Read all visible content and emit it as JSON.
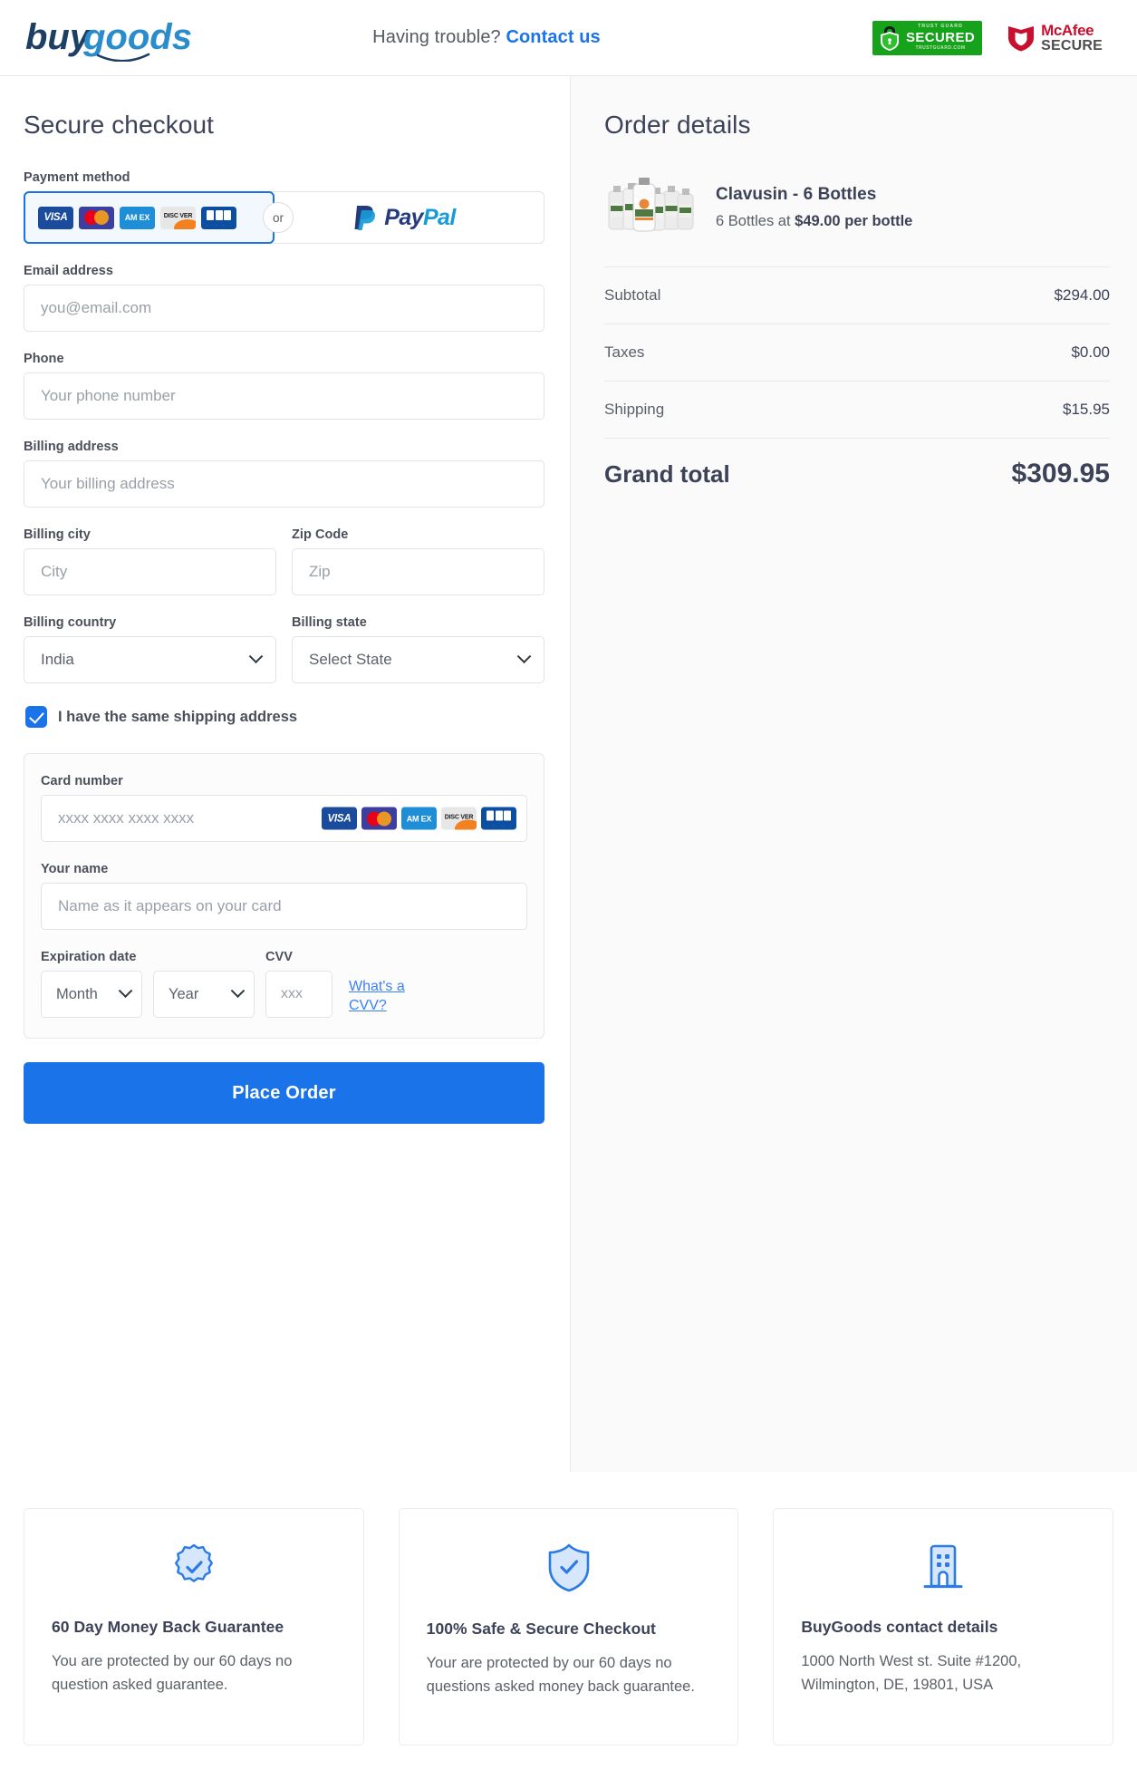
{
  "header": {
    "logo_text_1": "buy",
    "logo_text_2": "goods",
    "trouble_text": "Having trouble?",
    "contact_link": "Contact us",
    "badges": {
      "trustguard_top": "TRUST GUARD",
      "trustguard_mid": "SECURED",
      "trustguard_bottom": "TRUSTGUARD.COM",
      "mcafee_top": "McAfee",
      "mcafee_bottom": "SECURE"
    }
  },
  "checkout": {
    "title": "Secure checkout",
    "payment_method": {
      "label": "Payment method",
      "or_text": "or",
      "cards": [
        "VISA",
        "Mastercard",
        "AM EX",
        "DISCOVER",
        "JCB"
      ],
      "paypal_pay": "Pay",
      "paypal_pal": "Pal"
    },
    "email": {
      "label": "Email address",
      "placeholder": "you@email.com",
      "value": ""
    },
    "phone": {
      "label": "Phone",
      "placeholder": "Your phone number",
      "value": ""
    },
    "billing_address": {
      "label": "Billing address",
      "placeholder": "Your billing address",
      "value": ""
    },
    "billing_city": {
      "label": "Billing city",
      "placeholder": "City",
      "value": ""
    },
    "zip_code": {
      "label": "Zip Code",
      "placeholder": "Zip",
      "value": ""
    },
    "billing_country": {
      "label": "Billing country",
      "value": "India"
    },
    "billing_state": {
      "label": "Billing state",
      "value": "Select State"
    },
    "same_shipping": {
      "label": "I have the same shipping address",
      "checked": true
    },
    "card": {
      "number_label": "Card number",
      "number_placeholder": "xxxx xxxx xxxx xxxx",
      "name_label": "Your name",
      "name_placeholder": "Name as it appears on your card",
      "expiration_label": "Expiration date",
      "month_value": "Month",
      "year_value": "Year",
      "cvv_label": "CVV",
      "cvv_placeholder": "xxx",
      "cvv_help_link": "What's a CVV?"
    },
    "place_order_label": "Place Order"
  },
  "order": {
    "title": "Order details",
    "product": {
      "name": "Clavusin - 6 Bottles",
      "detail_prefix": "6 Bottles at ",
      "detail_price": "$49.00 per bottle"
    },
    "lines": [
      {
        "label": "Subtotal",
        "value": "$294.00"
      },
      {
        "label": "Taxes",
        "value": "$0.00"
      },
      {
        "label": "Shipping",
        "value": "$15.95"
      }
    ],
    "grand_total_label": "Grand total",
    "grand_total_value": "$309.95"
  },
  "footer": {
    "cards": [
      {
        "icon": "money-back-badge-icon",
        "title": "60 Day Money Back Guarantee",
        "text": "You are protected by our 60 days no question asked guarantee."
      },
      {
        "icon": "shield-check-icon",
        "title": "100% Safe & Secure Checkout",
        "text": "Your are protected by our 60 days no questions asked money back guarantee."
      },
      {
        "icon": "building-icon",
        "title": "BuyGoods contact details",
        "text": "1000 North West st. Suite #1200, Wilmington, DE, 19801, USA"
      }
    ]
  },
  "colors": {
    "accent_blue": "#1a73e8",
    "link_blue": "#3b82f6",
    "panel_bg": "#fafafa",
    "text_dark": "#3c4257"
  }
}
